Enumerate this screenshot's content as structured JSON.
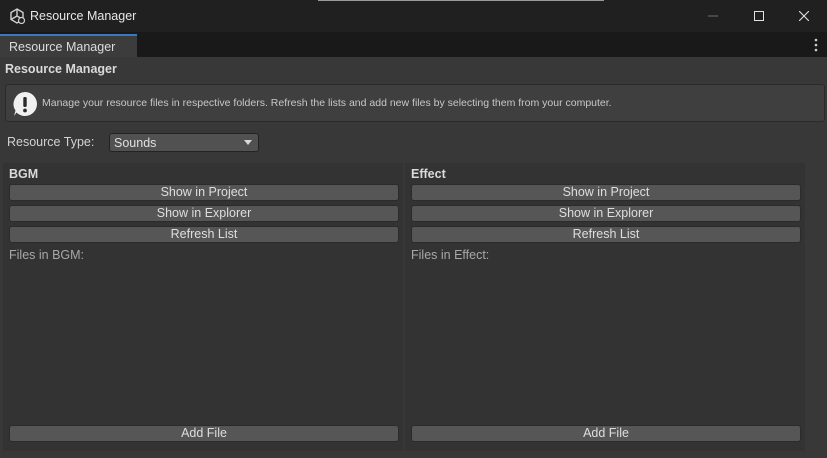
{
  "window": {
    "title": "Resource Manager",
    "controls": [
      "minimize",
      "maximize",
      "close"
    ]
  },
  "tab": {
    "label": "Resource Manager"
  },
  "header": {
    "title": "Resource Manager"
  },
  "help": {
    "message": "Manage your resource files in respective folders. Refresh the lists and add new files by selecting them from your computer."
  },
  "resource_type": {
    "label": "Resource Type:",
    "selected": "Sounds"
  },
  "panels": [
    {
      "title": "BGM",
      "show_in_project": "Show in Project",
      "show_in_explorer": "Show in Explorer",
      "refresh_list": "Refresh List",
      "files_label": "Files in BGM:",
      "add_file": "Add File"
    },
    {
      "title": "Effect",
      "show_in_project": "Show in Project",
      "show_in_explorer": "Show in Explorer",
      "refresh_list": "Refresh List",
      "files_label": "Files in Effect:",
      "add_file": "Add File"
    }
  ],
  "colors": {
    "tab_accent": "#3a79bb",
    "panel_bg": "#333333",
    "button_bg": "#565656"
  }
}
